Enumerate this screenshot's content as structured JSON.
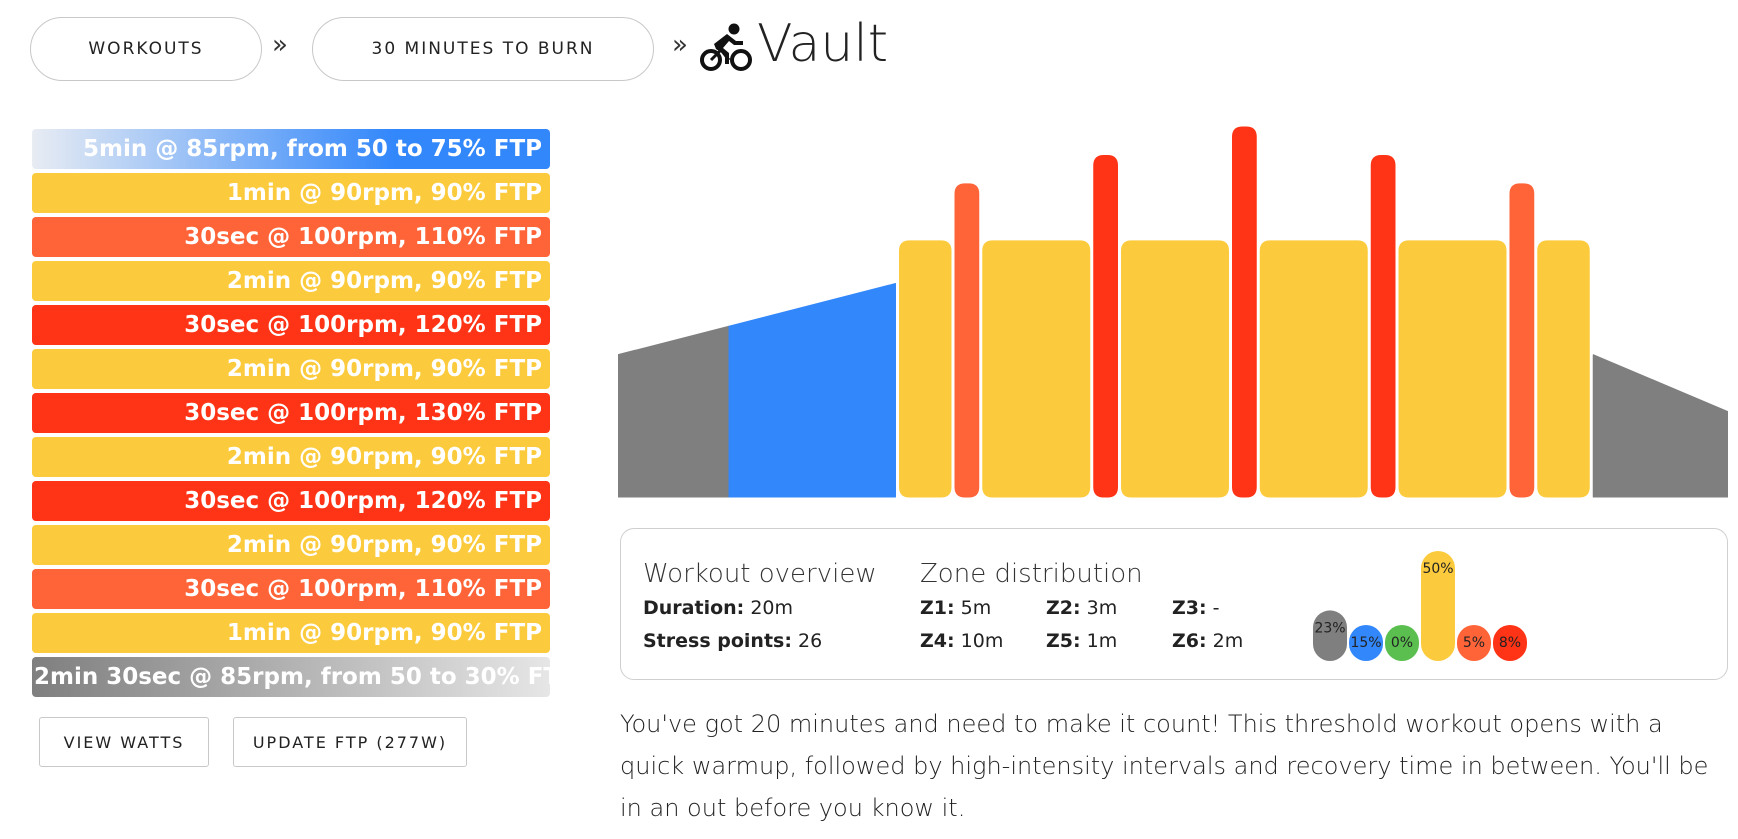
{
  "breadcrumb": {
    "workouts_label": "WORKOUTS",
    "category_label": "30 MINUTES TO BURN",
    "separator": "»",
    "title": "Vault"
  },
  "intervals": [
    {
      "label": "5min @ 85rpm, from 50 to 75% FTP",
      "color": "#3287fb",
      "kind": "ramp-up"
    },
    {
      "label": "1min @ 90rpm, 90% FTP",
      "color": "#fccb3d"
    },
    {
      "label": "30sec @ 100rpm, 110% FTP",
      "color": "#ff6338"
    },
    {
      "label": "2min @ 90rpm, 90% FTP",
      "color": "#fccb3d"
    },
    {
      "label": "30sec @ 100rpm, 120% FTP",
      "color": "#ff3315"
    },
    {
      "label": "2min @ 90rpm, 90% FTP",
      "color": "#fccb3d"
    },
    {
      "label": "30sec @ 100rpm, 130% FTP",
      "color": "#ff3315"
    },
    {
      "label": "2min @ 90rpm, 90% FTP",
      "color": "#fccb3d"
    },
    {
      "label": "30sec @ 100rpm, 120% FTP",
      "color": "#ff3315"
    },
    {
      "label": "2min @ 90rpm, 90% FTP",
      "color": "#fccb3d"
    },
    {
      "label": "30sec @ 100rpm, 110% FTP",
      "color": "#ff6338"
    },
    {
      "label": "1min @ 90rpm, 90% FTP",
      "color": "#fccb3d"
    },
    {
      "label": "2min 30sec @ 85rpm, from 50 to 30% FTP",
      "color": "#7f7f7f",
      "kind": "ramp-down"
    }
  ],
  "buttons": {
    "view_watts": "VIEW WATTS",
    "update_ftp": "UPDATE FTP (277W)"
  },
  "overview": {
    "heading": "Workout overview",
    "duration_label": "Duration:",
    "duration_value": "20m",
    "stress_label": "Stress points:",
    "stress_value": "26"
  },
  "zones": {
    "heading": "Zone distribution",
    "items": [
      {
        "label": "Z1:",
        "value": "5m"
      },
      {
        "label": "Z2:",
        "value": "3m"
      },
      {
        "label": "Z3:",
        "value": "-"
      },
      {
        "label": "Z4:",
        "value": "10m"
      },
      {
        "label": "Z5:",
        "value": "1m"
      },
      {
        "label": "Z6:",
        "value": "2m"
      }
    ],
    "distribution": [
      {
        "pct": 23,
        "label": "23%",
        "color": "#7f7f7f"
      },
      {
        "pct": 15,
        "label": "15%",
        "color": "#3287fb"
      },
      {
        "pct": 0,
        "label": "0%",
        "color": "#5bbf50"
      },
      {
        "pct": 50,
        "label": "50%",
        "color": "#fccb3d"
      },
      {
        "pct": 5,
        "label": "5%",
        "color": "#ff6338"
      },
      {
        "pct": 8,
        "label": "8%",
        "color": "#ff3315"
      }
    ]
  },
  "description": "You've got 20 minutes and need to make it count! This threshold workout opens with a quick warmup, followed by high-intensity intervals and recovery time in between. You'll be in an out before you know it.",
  "chart_data": {
    "type": "bar",
    "x_unit": "seconds",
    "y_unit": "% FTP",
    "segments": [
      {
        "start": 0,
        "duration": 120,
        "from": 50,
        "to": 60,
        "color": "#7f7f7f"
      },
      {
        "start": 120,
        "duration": 180,
        "from": 60,
        "to": 75,
        "color": "#3287fb"
      },
      {
        "start": 300,
        "duration": 60,
        "from": 90,
        "to": 90,
        "color": "#fccb3d"
      },
      {
        "start": 360,
        "duration": 30,
        "from": 110,
        "to": 110,
        "color": "#ff6338"
      },
      {
        "start": 390,
        "duration": 120,
        "from": 90,
        "to": 90,
        "color": "#fccb3d"
      },
      {
        "start": 510,
        "duration": 30,
        "from": 120,
        "to": 120,
        "color": "#ff3315"
      },
      {
        "start": 540,
        "duration": 120,
        "from": 90,
        "to": 90,
        "color": "#fccb3d"
      },
      {
        "start": 660,
        "duration": 30,
        "from": 130,
        "to": 130,
        "color": "#ff3315"
      },
      {
        "start": 690,
        "duration": 120,
        "from": 90,
        "to": 90,
        "color": "#fccb3d"
      },
      {
        "start": 810,
        "duration": 30,
        "from": 120,
        "to": 120,
        "color": "#ff3315"
      },
      {
        "start": 840,
        "duration": 120,
        "from": 90,
        "to": 90,
        "color": "#fccb3d"
      },
      {
        "start": 960,
        "duration": 30,
        "from": 110,
        "to": 110,
        "color": "#ff6338"
      },
      {
        "start": 990,
        "duration": 60,
        "from": 90,
        "to": 90,
        "color": "#fccb3d"
      },
      {
        "start": 1050,
        "duration": 150,
        "from": 50,
        "to": 30,
        "color": "#7f7f7f"
      }
    ],
    "ylim": [
      0,
      130
    ]
  }
}
